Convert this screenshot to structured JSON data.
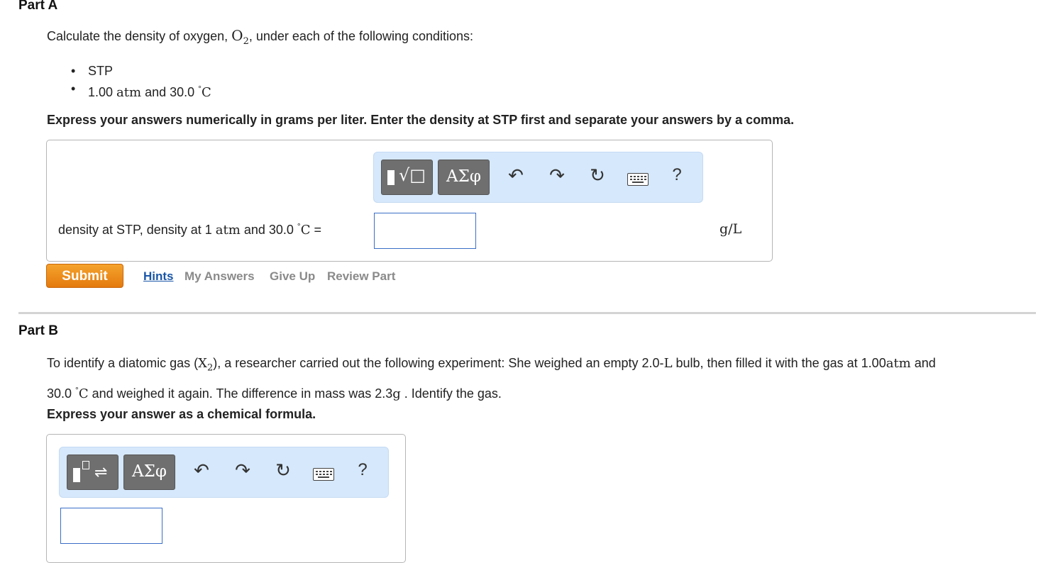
{
  "part_a": {
    "title": "Part A",
    "prompt_prefix": "Calculate the density of oxygen, ",
    "formula_main": "O",
    "formula_sub": "2",
    "prompt_suffix": ", under each of the following conditions:",
    "bullets": [
      {
        "text": "STP"
      },
      {
        "num": "1.00 ",
        "unit": "atm",
        "mid": " and 30.0 ",
        "deg": "°",
        "deg_unit": "C"
      }
    ],
    "instruction": "Express your answers numerically in grams per liter. Enter the density at STP first and separate your answers by a comma.",
    "toolbar": {
      "template_label": "√□",
      "greek_label": "ΑΣφ",
      "undo": "↶",
      "redo": "↷",
      "reset": "↻",
      "help": "?"
    },
    "answer_label": {
      "pre": "density at STP, density at 1 ",
      "atm": "atm",
      "mid": " and 30.0 ",
      "deg": "°",
      "c": "C",
      "eq": " ="
    },
    "answer_value": "",
    "unit": "g/L",
    "submit_label": "Submit",
    "links": [
      "Hints",
      "My Answers",
      "Give Up",
      "Review Part"
    ]
  },
  "part_b": {
    "title": "Part B",
    "line1_a": "To identify a diatomic gas (",
    "x": "X",
    "x_sub": "2",
    "line1_b": "), a researcher carried out the following experiment: She weighed an empty 2.0-",
    "L": "L",
    "line1_c": " bulb, then filled it with the gas at 1.00",
    "atm": "atm",
    "line1_d": " and",
    "line2_a": "30.0 ",
    "deg": "°",
    "c": "C",
    "line2_b": " and weighed it again. The difference in mass was 2.3",
    "g": "g",
    "line2_c": " . Identify the gas.",
    "instruction": "Express your answer as a chemical formula.",
    "toolbar": {
      "greek_label": "ΑΣφ",
      "undo": "↶",
      "redo": "↷",
      "reset": "↻",
      "help": "?"
    },
    "answer_value": ""
  },
  "colors": {
    "accent_submit": "#ee8a1a",
    "link_blue": "#1a56a8",
    "toolbar_bg": "#d6e8fb",
    "input_border": "#3a6ec7"
  }
}
